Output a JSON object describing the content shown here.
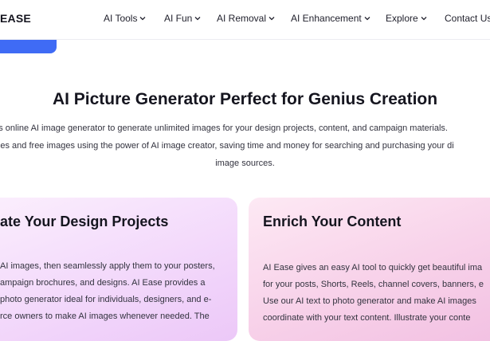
{
  "nav": {
    "logo": "EASE",
    "items": [
      {
        "label": "AI Tools"
      },
      {
        "label": "AI Fun"
      },
      {
        "label": "AI Removal"
      },
      {
        "label": "AI Enhancement"
      },
      {
        "label": "Explore"
      },
      {
        "label": "Contact Us"
      }
    ]
  },
  "hero": {
    "title": "AI Picture Generator Perfect for Genius Creation",
    "intro": [
      "e's online AI image generator to generate unlimited images for your design projects, content, and campaign materials.",
      "lities and free images using the power of AI image creator, saving time and money for searching and purchasing your di",
      "image sources."
    ]
  },
  "cards": [
    {
      "title": "ate Your Design Projects",
      "lines": [
        "AI images, then seamlessly apply them to your posters,",
        "ampaign brochures, and designs. AI Ease provides a",
        "photo generator ideal for individuals, designers, and e-",
        "rce owners to make AI images whenever needed. The"
      ]
    },
    {
      "title": "Enrich Your Content",
      "lines": [
        "AI Ease gives an easy AI tool to quickly get beautiful ima",
        "for your posts, Shorts, Reels, channel covers, banners, e",
        "Use our AI text to photo generator and make AI images",
        "coordinate with your text content. Illustrate your conte"
      ]
    }
  ]
}
